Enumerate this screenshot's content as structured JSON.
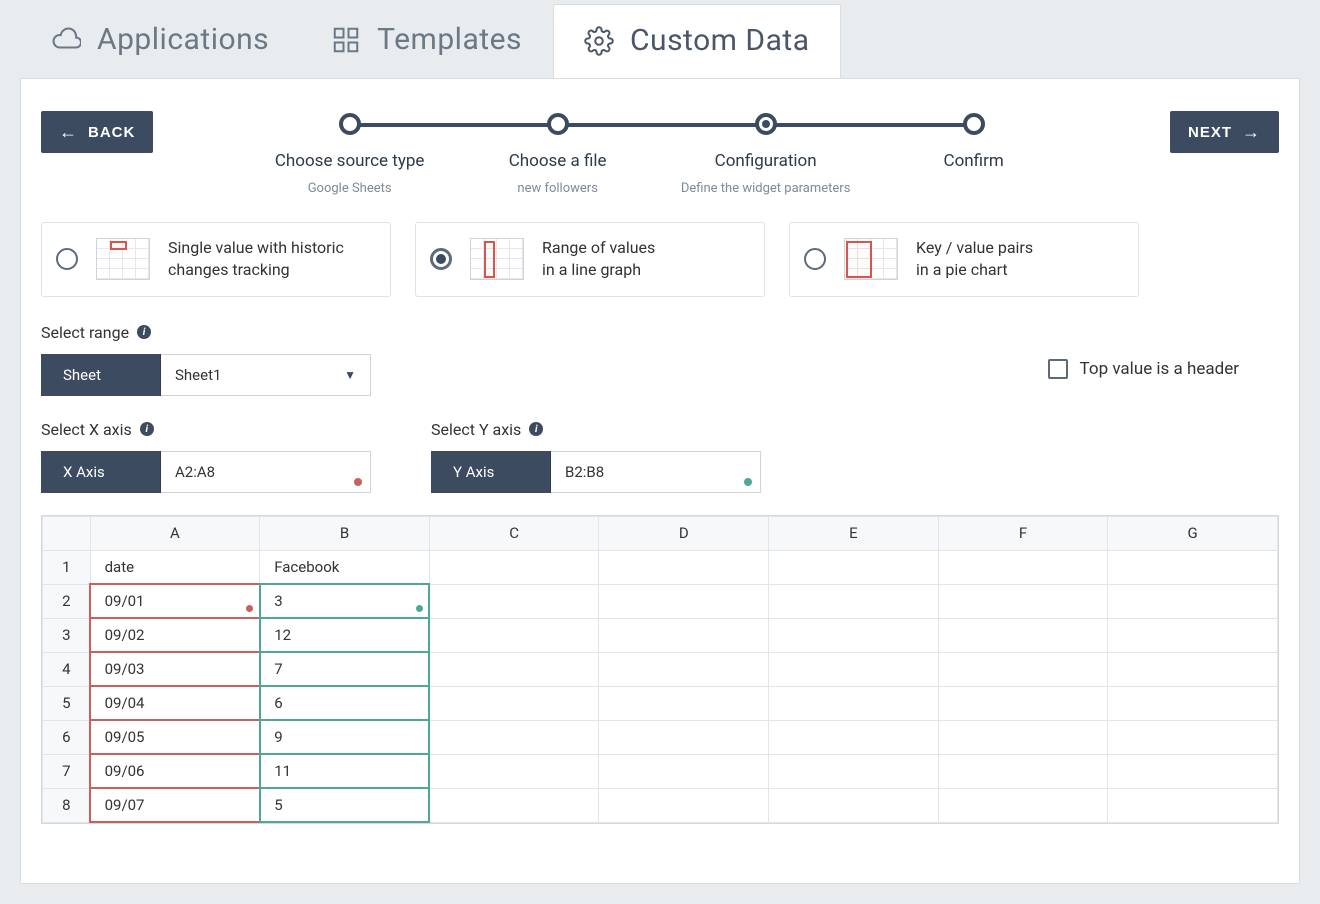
{
  "tabs": {
    "applications": "Applications",
    "templates": "Templates",
    "custom_data": "Custom Data"
  },
  "buttons": {
    "back": "BACK",
    "next": "NEXT"
  },
  "stepper": [
    {
      "title": "Choose source type",
      "sub": "Google Sheets"
    },
    {
      "title": "Choose a file",
      "sub": "new followers"
    },
    {
      "title": "Configuration",
      "sub": "Define the widget parameters"
    },
    {
      "title": "Confirm",
      "sub": ""
    }
  ],
  "options": [
    {
      "line1": "Single value with historic",
      "line2": "changes tracking"
    },
    {
      "line1": "Range of values",
      "line2": "in a line graph"
    },
    {
      "line1": "Key / value pairs",
      "line2": "in a pie chart"
    }
  ],
  "range": {
    "section": "Select range",
    "sheet_label": "Sheet",
    "sheet_value": "Sheet1",
    "header_checkbox": "Top value is a header"
  },
  "axes": {
    "x_section": "Select X axis",
    "x_label": "X Axis",
    "x_value": "A2:A8",
    "y_section": "Select Y axis",
    "y_label": "Y Axis",
    "y_value": "B2:B8"
  },
  "sheet": {
    "columns": [
      "A",
      "B",
      "C",
      "D",
      "E",
      "F",
      "G"
    ],
    "rows": [
      {
        "n": "1",
        "a": "date",
        "b": "Facebook"
      },
      {
        "n": "2",
        "a": "09/01",
        "b": "3"
      },
      {
        "n": "3",
        "a": "09/02",
        "b": "12"
      },
      {
        "n": "4",
        "a": "09/03",
        "b": "7"
      },
      {
        "n": "5",
        "a": "09/04",
        "b": "6"
      },
      {
        "n": "6",
        "a": "09/05",
        "b": "9"
      },
      {
        "n": "7",
        "a": "09/06",
        "b": "11"
      },
      {
        "n": "8",
        "a": "09/07",
        "b": "5"
      }
    ]
  },
  "colors": {
    "x_axis": "#c9605c",
    "y_axis": "#4fa896"
  }
}
